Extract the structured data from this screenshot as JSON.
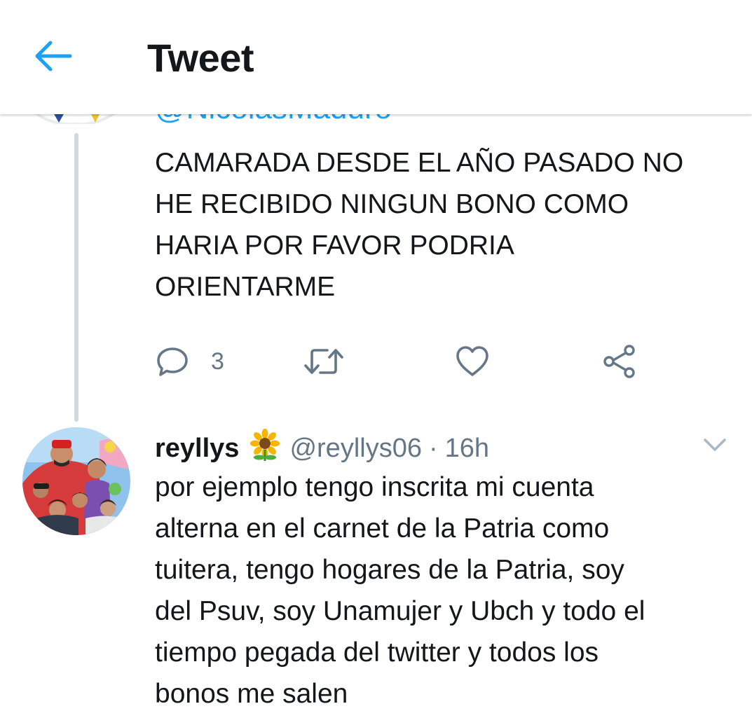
{
  "header": {
    "title": "Tweet",
    "back_icon": "arrow-left-icon",
    "accent_color": "#1da1f2"
  },
  "parent_tweet": {
    "handle_cut": "@NicolasMaduro",
    "text_lines": [
      "CAMARADA DESDE EL AÑO PASADO NO",
      "HE RECIBIDO NINGUN BONO COMO",
      "HARIA POR FAVOR PODRIA",
      "ORIENTARME"
    ],
    "actions": {
      "reply_icon": "reply-icon",
      "reply_count": "3",
      "retweet_icon": "retweet-icon",
      "like_icon": "heart-icon",
      "share_icon": "share-icon"
    }
  },
  "reply_tweet": {
    "name": "reyllys",
    "emoji": "🌻",
    "handle": "@reyllys06",
    "separator": "·",
    "time": "16h",
    "menu_icon": "chevron-down-icon",
    "text_lines": [
      "por ejemplo tengo inscrita mi cuenta",
      "alterna en el carnet de la Patria como",
      "tuitera, tengo hogares de la Patria, soy",
      "del Psuv, soy Unamujer y Ubch y todo el",
      "tiempo pegada del twitter y todos los",
      "bonos me salen"
    ]
  }
}
